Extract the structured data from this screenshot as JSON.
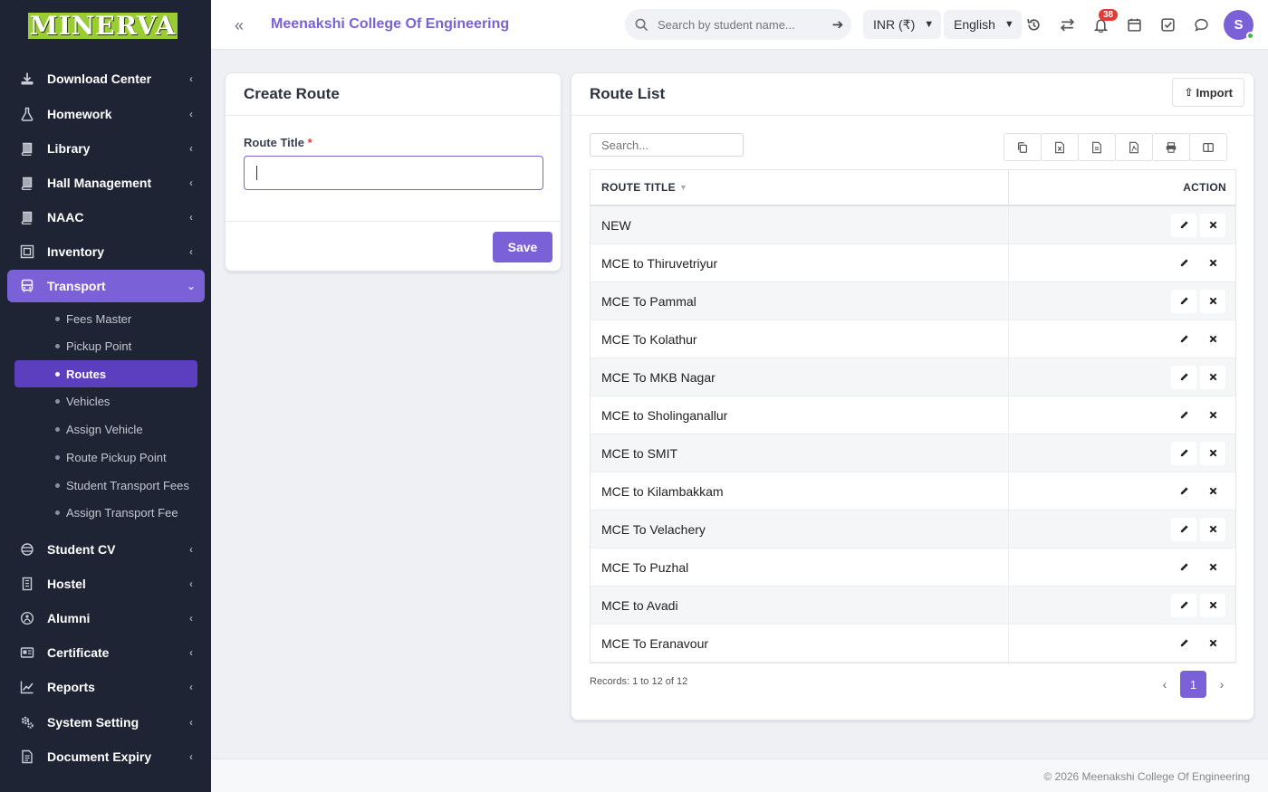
{
  "brand": {
    "logo_text": "MINERVA"
  },
  "sidebar": {
    "items": [
      {
        "label": "Download Center",
        "icon": "download-icon"
      },
      {
        "label": "Homework",
        "icon": "flask-icon"
      },
      {
        "label": "Library",
        "icon": "book-icon"
      },
      {
        "label": "Hall Management",
        "icon": "book-icon"
      },
      {
        "label": "NAAC",
        "icon": "book-icon"
      },
      {
        "label": "Inventory",
        "icon": "inventory-icon"
      },
      {
        "label": "Transport",
        "icon": "bus-icon",
        "active": true
      },
      {
        "label": "Student CV",
        "icon": "cv-icon"
      },
      {
        "label": "Hostel",
        "icon": "building-icon"
      },
      {
        "label": "Alumni",
        "icon": "alumni-icon"
      },
      {
        "label": "Certificate",
        "icon": "certificate-icon"
      },
      {
        "label": "Reports",
        "icon": "chart-icon"
      },
      {
        "label": "System Setting",
        "icon": "gears-icon"
      },
      {
        "label": "Document Expiry",
        "icon": "document-icon"
      }
    ],
    "transport_sub": [
      {
        "label": "Fees Master"
      },
      {
        "label": "Pickup Point"
      },
      {
        "label": "Routes",
        "active": true
      },
      {
        "label": "Vehicles"
      },
      {
        "label": "Assign Vehicle"
      },
      {
        "label": "Route Pickup Point"
      },
      {
        "label": "Student Transport Fees"
      },
      {
        "label": "Assign Transport Fee"
      }
    ]
  },
  "header": {
    "college_name": "Meenakshi College Of Engineering",
    "search_placeholder": "Search by student name...",
    "currency": "INR (₹)",
    "language": "English",
    "notification_count": "38",
    "avatar_initial": "S"
  },
  "create_route": {
    "title": "Create Route",
    "field_label": "Route Title",
    "required_mark": "*",
    "field_value": "",
    "save_label": "Save"
  },
  "route_list": {
    "title": "Route List",
    "import_label": "Import",
    "search_placeholder": "Search...",
    "columns": {
      "title": "ROUTE TITLE",
      "action": "ACTION"
    },
    "rows": [
      "NEW",
      "MCE to Thiruvetriyur",
      "MCE To Pammal",
      "MCE To Kolathur",
      "MCE To MKB Nagar",
      "MCE to Sholinganallur",
      "MCE to SMIT",
      "MCE to Kilambakkam",
      "MCE To Velachery",
      "MCE To Puzhal",
      "MCE to Avadi",
      "MCE To Eranavour"
    ],
    "records_text": "Records: 1 to 12 of 12",
    "current_page": "1"
  },
  "footer": {
    "text": "© 2026 Meenakshi College Of Engineering"
  },
  "colors": {
    "accent": "#7b61d8",
    "sidebar_bg": "#1e2433",
    "badge": "#e53935"
  }
}
